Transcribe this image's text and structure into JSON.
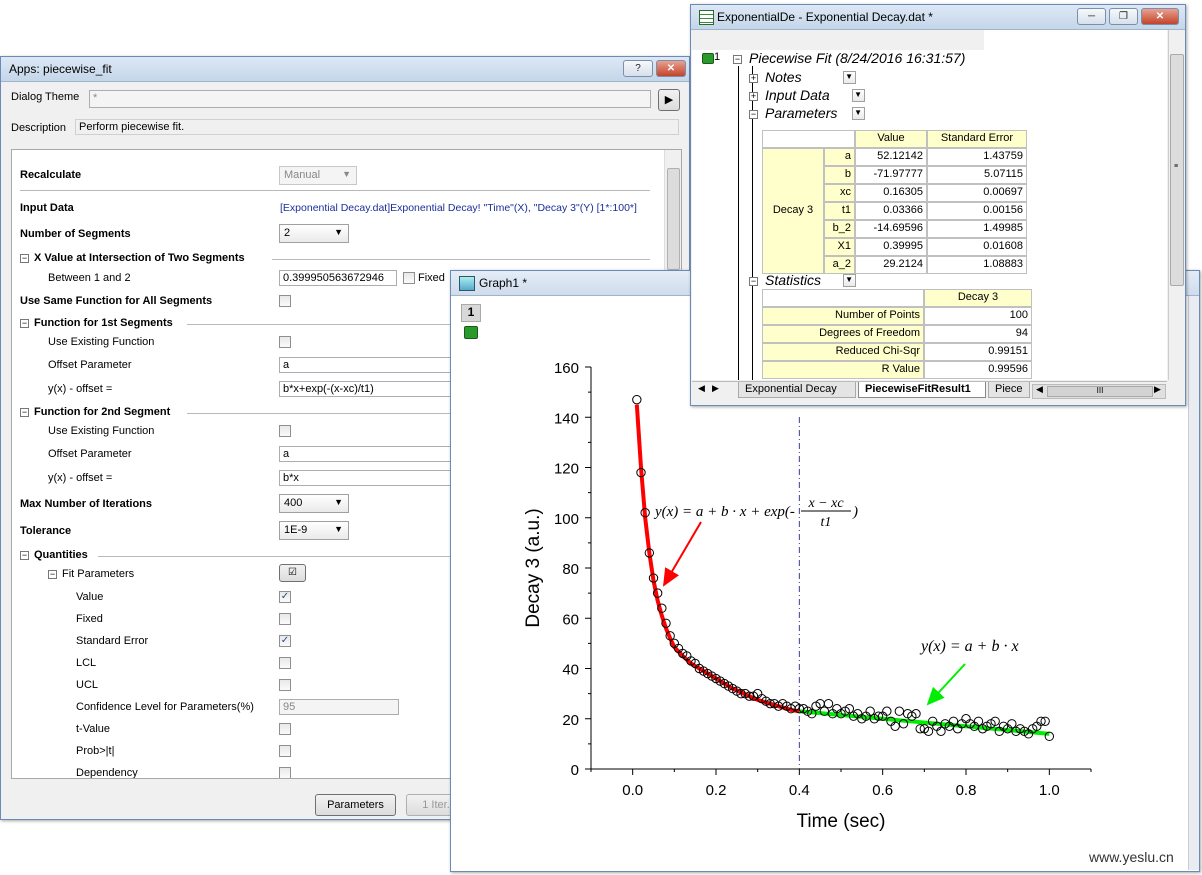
{
  "dialog": {
    "title": "Apps: piecewise_fit",
    "help_btn": "?",
    "close_btn": "✕",
    "dialog_theme_label": "Dialog Theme",
    "dialog_theme_value": "*",
    "description_label": "Description",
    "description_value": "Perform piecewise fit.",
    "recalculate_label": "Recalculate",
    "recalculate_value": "Manual",
    "input_data_label": "Input Data",
    "input_data_value": "[Exponential Decay.dat]Exponential Decay! \"Time\"(X), \"Decay 3\"(Y) [1*:100*]",
    "num_segments_label": "Number of Segments",
    "num_segments_value": "2",
    "x_intersection_label": "X Value at Intersection of Two Segments",
    "between_label": "Between 1 and 2",
    "between_value": "0.399950563672946",
    "fixed_label": "Fixed",
    "same_function_label": "Use Same Function for All Segments",
    "func1_label": "Function for 1st Segments",
    "func1_use_existing": "Use Existing Function",
    "func1_offset_label": "Offset Parameter",
    "func1_offset_value": "a",
    "func1_expr_label": "y(x) - offset =",
    "func1_expr_value": "b*x+exp(-(x-xc)/t1)",
    "func2_label": "Function for 2nd Segment",
    "func2_use_existing": "Use Existing Function",
    "func2_offset_label": "Offset Parameter",
    "func2_offset_value": "a",
    "func2_expr_label": "y(x) - offset =",
    "func2_expr_value": "b*x",
    "max_iter_label": "Max Number of Iterations",
    "max_iter_value": "400",
    "tolerance_label": "Tolerance",
    "tolerance_value": "1E-9",
    "quantities_label": "Quantities",
    "fit_params_label": "Fit Parameters",
    "items": [
      {
        "label": "Value",
        "checked": true
      },
      {
        "label": "Fixed",
        "checked": false
      },
      {
        "label": "Standard Error",
        "checked": true
      },
      {
        "label": "LCL",
        "checked": false
      },
      {
        "label": "UCL",
        "checked": false
      },
      {
        "label": "Confidence Level for Parameters(%)",
        "field": "95"
      },
      {
        "label": "t-Value",
        "checked": false
      },
      {
        "label": "Prob>|t|",
        "checked": false
      },
      {
        "label": "Dependency",
        "checked": false
      }
    ],
    "parameters_btn": "Parameters",
    "iter_btn": "1 Iter."
  },
  "workbook": {
    "title": "ExponentialDe - Exponential Decay.dat *",
    "row_num": "1",
    "report_title": "Piecewise Fit (8/24/2016 16:31:57)",
    "notes": "Notes",
    "input_data": "Input Data",
    "parameters": "Parameters",
    "statistics": "Statistics",
    "param_headers": [
      "Value",
      "Standard Error"
    ],
    "param_group": "Decay 3",
    "param_rows": [
      {
        "name": "a",
        "value": "52.12142",
        "err": "1.43759"
      },
      {
        "name": "b",
        "value": "-71.97777",
        "err": "5.07115"
      },
      {
        "name": "xc",
        "value": "0.16305",
        "err": "0.00697"
      },
      {
        "name": "t1",
        "value": "0.03366",
        "err": "0.00156"
      },
      {
        "name": "b_2",
        "value": "-14.69596",
        "err": "1.49985"
      },
      {
        "name": "X1",
        "value": "0.39995",
        "err": "0.01608"
      },
      {
        "name": "a_2",
        "value": "29.2124",
        "err": "1.08883"
      }
    ],
    "stat_header": "Decay 3",
    "stat_rows": [
      {
        "name": "Number of Points",
        "value": "100"
      },
      {
        "name": "Degrees of Freedom",
        "value": "94"
      },
      {
        "name": "Reduced Chi-Sqr",
        "value": "0.99151"
      },
      {
        "name": "R Value",
        "value": "0.99596"
      }
    ],
    "tabs": [
      "Exponential Decay",
      "PiecewiseFitResult1",
      "Piece"
    ],
    "scroll_mark": "III"
  },
  "graph": {
    "title": "Graph1 *",
    "layer_num": "1",
    "watermark": "www.yeslu.cn",
    "eq1": "y(x) = a + b · x + exp(-",
    "eq1_num": "x − xc",
    "eq1_den": "t1",
    "eq1_close": ")",
    "eq2": "y(x) = a + b · x",
    "colors": {
      "fit1": "#ff0000",
      "fit2": "#00ee00",
      "points": "#000000",
      "divider": "#3a3a9a"
    }
  },
  "chart_data": {
    "type": "scatter",
    "xlabel": "Time (sec)",
    "ylabel": "Decay 3 (a.u.)",
    "xlim": [
      -0.1,
      1.1
    ],
    "ylim": [
      0,
      160
    ],
    "xticks": [
      "0.0",
      "0.2",
      "0.4",
      "0.6",
      "0.8",
      "1.0"
    ],
    "yticks": [
      "0",
      "20",
      "40",
      "60",
      "80",
      "100",
      "120",
      "140",
      "160"
    ],
    "breakpoint_x": 0.4,
    "points_x": [
      0.01,
      0.02,
      0.03,
      0.04,
      0.05,
      0.06,
      0.07,
      0.08,
      0.09,
      0.1,
      0.11,
      0.12,
      0.13,
      0.14,
      0.15,
      0.16,
      0.17,
      0.18,
      0.19,
      0.2,
      0.21,
      0.22,
      0.23,
      0.24,
      0.25,
      0.26,
      0.27,
      0.28,
      0.29,
      0.3,
      0.31,
      0.32,
      0.33,
      0.34,
      0.35,
      0.36,
      0.37,
      0.38,
      0.39,
      0.4,
      0.41,
      0.42,
      0.43,
      0.44,
      0.45,
      0.46,
      0.47,
      0.48,
      0.49,
      0.5,
      0.51,
      0.52,
      0.53,
      0.54,
      0.55,
      0.56,
      0.57,
      0.58,
      0.59,
      0.6,
      0.61,
      0.62,
      0.63,
      0.64,
      0.65,
      0.66,
      0.67,
      0.68,
      0.69,
      0.7,
      0.71,
      0.72,
      0.73,
      0.74,
      0.75,
      0.76,
      0.77,
      0.78,
      0.79,
      0.8,
      0.81,
      0.82,
      0.83,
      0.84,
      0.85,
      0.86,
      0.87,
      0.88,
      0.89,
      0.9,
      0.91,
      0.92,
      0.93,
      0.94,
      0.95,
      0.96,
      0.97,
      0.98,
      0.99,
      1.0
    ],
    "points_y": [
      147,
      118,
      102,
      86,
      76,
      70,
      64,
      58,
      53,
      50,
      48,
      46,
      45,
      43,
      42,
      40,
      39,
      38,
      37,
      36,
      35,
      34,
      33,
      32,
      31,
      30,
      30,
      29,
      29,
      30,
      28,
      27,
      26,
      26,
      25,
      26,
      25,
      24,
      25,
      24,
      24,
      23,
      22,
      25,
      26,
      23,
      26,
      22,
      24,
      22,
      23,
      24,
      21,
      22,
      20,
      21,
      23,
      20,
      21,
      21,
      23,
      19,
      17,
      23,
      18,
      22,
      21,
      22,
      16,
      16,
      15,
      19,
      17,
      15,
      18,
      17,
      19,
      16,
      18,
      20,
      18,
      17,
      19,
      16,
      17,
      18,
      19,
      15,
      17,
      16,
      18,
      15,
      16,
      15,
      14,
      16,
      17,
      19,
      19,
      13
    ],
    "fit1_x": [
      0.01,
      0.02,
      0.03,
      0.04,
      0.05,
      0.06,
      0.07,
      0.08,
      0.09,
      0.1,
      0.12,
      0.14,
      0.16,
      0.18,
      0.2,
      0.22,
      0.24,
      0.26,
      0.28,
      0.3,
      0.32,
      0.34,
      0.36,
      0.38,
      0.4
    ],
    "fit1_y": [
      145,
      120,
      100,
      86,
      75,
      67,
      61,
      56,
      52,
      48.5,
      45,
      42,
      40,
      38,
      36,
      34,
      32,
      30.5,
      29,
      27.5,
      26.5,
      25.5,
      24.5,
      23.5,
      23
    ],
    "fit2_x": [
      0.4,
      1.0
    ],
    "fit2_y": [
      23,
      14
    ]
  }
}
